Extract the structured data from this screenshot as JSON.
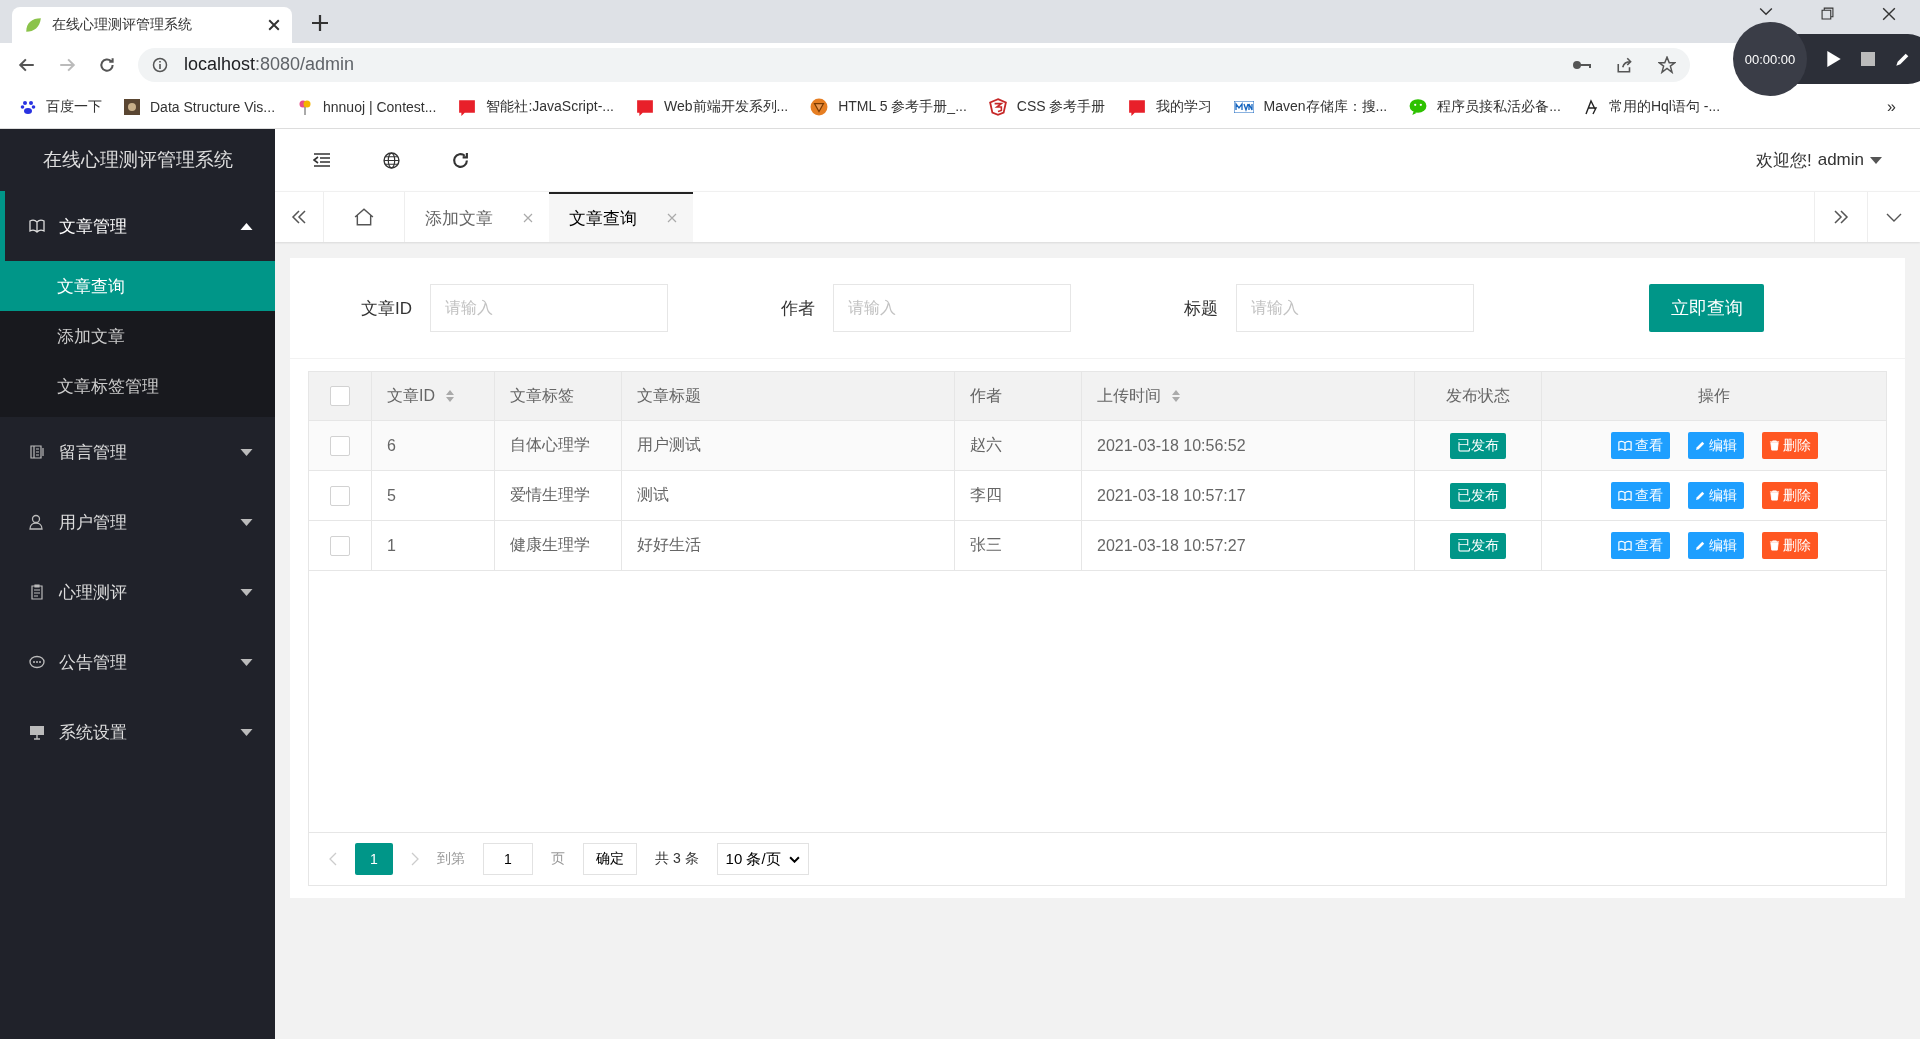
{
  "browser": {
    "tab_title": "在线心理测评管理系统",
    "url_host": "localhost",
    "url_path": ":8080/admin",
    "bookmarks": [
      {
        "label": "百度一下",
        "kind": "paw"
      },
      {
        "label": "Data Structure Vis...",
        "kind": "photo"
      },
      {
        "label": "hnnuoj | Contest...",
        "kind": "balloon"
      },
      {
        "label": "智能社:JavaScript-...",
        "kind": "book"
      },
      {
        "label": "Web前端开发系列...",
        "kind": "book"
      },
      {
        "label": "HTML 5 参考手册_...",
        "kind": "badge"
      },
      {
        "label": "CSS 参考手册",
        "kind": "shield"
      },
      {
        "label": "我的学习",
        "kind": "book"
      },
      {
        "label": "Maven存储库：搜...",
        "kind": "mvn"
      },
      {
        "label": "程序员接私活必备...",
        "kind": "chat"
      },
      {
        "label": "常用的Hql语句 -...",
        "kind": "glyph"
      }
    ],
    "more": "»"
  },
  "recorder": {
    "time": "00:00:00"
  },
  "sidebar": {
    "title": "在线心理测评管理系统",
    "items": [
      {
        "label": "文章管理",
        "expanded": true,
        "children": [
          {
            "label": "文章查询",
            "selected": true
          },
          {
            "label": "添加文章",
            "selected": false
          },
          {
            "label": "文章标签管理",
            "selected": false
          }
        ]
      },
      {
        "label": "留言管理",
        "expanded": false
      },
      {
        "label": "用户管理",
        "expanded": false
      },
      {
        "label": "心理测评",
        "expanded": false
      },
      {
        "label": "公告管理",
        "expanded": false
      },
      {
        "label": "系统设置",
        "expanded": false
      }
    ]
  },
  "header": {
    "welcome": "欢迎您!",
    "user": "admin"
  },
  "tabs": [
    {
      "label": "添加文章",
      "selected": false
    },
    {
      "label": "文章查询",
      "selected": true
    }
  ],
  "search": {
    "fields": [
      {
        "label": "文章ID",
        "placeholder": "请输入"
      },
      {
        "label": "作者",
        "placeholder": "请输入"
      },
      {
        "label": "标题",
        "placeholder": "请输入"
      }
    ],
    "button": "立即查询"
  },
  "table": {
    "all_checked": false,
    "columns": [
      {
        "label": "文章ID",
        "sortable": true
      },
      {
        "label": "文章标签",
        "sortable": false
      },
      {
        "label": "文章标题",
        "sortable": false
      },
      {
        "label": "作者",
        "sortable": false
      },
      {
        "label": "上传时间",
        "sortable": true
      },
      {
        "label": "发布状态",
        "sortable": false
      },
      {
        "label": "操作",
        "sortable": false
      }
    ],
    "rows": [
      {
        "checked": false,
        "id": "6",
        "tag": "自体心理学",
        "title": "用户测试",
        "author": "赵六",
        "time": "2021-03-18 10:56:52",
        "status": "已发布",
        "actions": [
          {
            "kind": "view",
            "label": "查看"
          },
          {
            "kind": "edit",
            "label": "编辑"
          },
          {
            "kind": "delete",
            "label": "删除"
          }
        ]
      },
      {
        "checked": false,
        "id": "5",
        "tag": "爱情生理学",
        "title": "测试",
        "author": "李四",
        "time": "2021-03-18 10:57:17",
        "status": "已发布",
        "actions": [
          {
            "kind": "view",
            "label": "查看"
          },
          {
            "kind": "edit",
            "label": "编辑"
          },
          {
            "kind": "delete",
            "label": "删除"
          }
        ]
      },
      {
        "checked": false,
        "id": "1",
        "tag": "健康生理学",
        "title": "好好生活",
        "author": "张三",
        "time": "2021-03-18 10:57:27",
        "status": "已发布",
        "actions": [
          {
            "kind": "view",
            "label": "查看"
          },
          {
            "kind": "edit",
            "label": "编辑"
          },
          {
            "kind": "delete",
            "label": "删除"
          }
        ]
      }
    ]
  },
  "pagination": {
    "current": "1",
    "goto_label": "到第",
    "goto_value": "1",
    "page_label": "页",
    "confirm": "确定",
    "total": "共 3 条",
    "page_size": "10 条/页"
  }
}
